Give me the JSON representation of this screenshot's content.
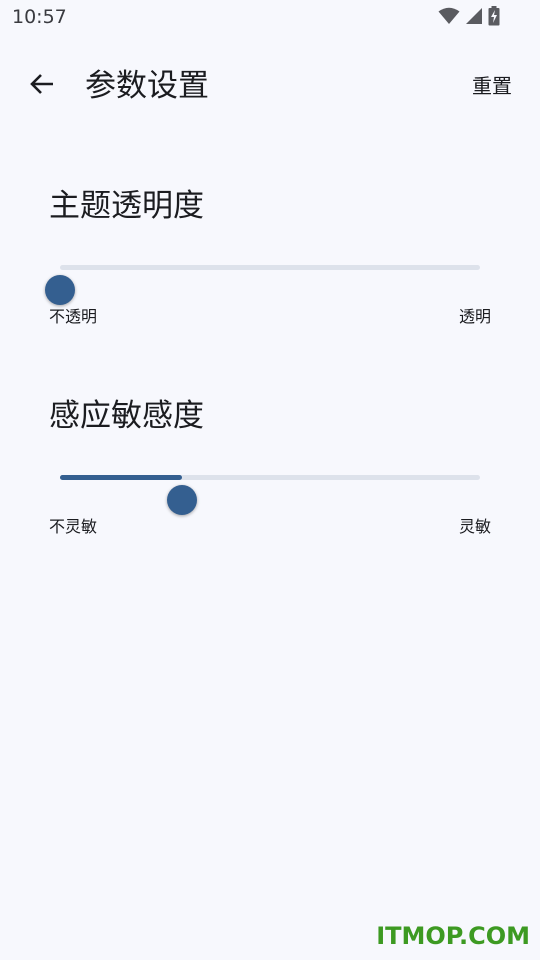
{
  "status_bar": {
    "time": "10:57",
    "icons": [
      "wifi-icon",
      "signal-icon",
      "battery-charging-icon"
    ]
  },
  "app_bar": {
    "back_icon": "arrow-left-icon",
    "title": "参数设置",
    "reset_label": "重置"
  },
  "settings": [
    {
      "title": "主题透明度",
      "min_label": "不透明",
      "max_label": "透明",
      "value": 0.0
    },
    {
      "title": "感应敏感度",
      "min_label": "不灵敏",
      "max_label": "灵敏",
      "value": 0.29
    }
  ],
  "watermark": "ITMOP.COM",
  "colors": {
    "background": "#f7f8fd",
    "accent": "#345f90",
    "track_inactive": "#dde2eb",
    "watermark": "#3d9a22"
  }
}
